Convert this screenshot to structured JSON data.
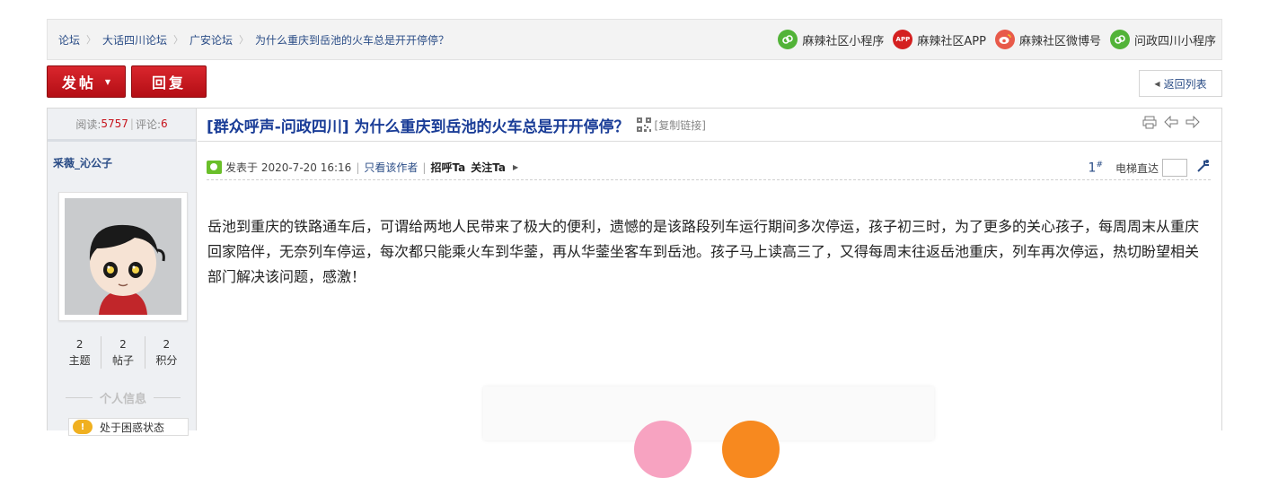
{
  "breadcrumb": {
    "items": [
      "论坛",
      "大话四川论坛",
      "广安论坛",
      "为什么重庆到岳池的火车总是开开停停？"
    ]
  },
  "quicklinks": [
    {
      "icon": "wechat-mini-program-icon",
      "label": "麻辣社区小程序"
    },
    {
      "icon": "app-icon",
      "icon_text": "APP",
      "label": "麻辣社区APP"
    },
    {
      "icon": "weibo-icon",
      "label": "麻辣社区微博号"
    },
    {
      "icon": "wechat-mini-program-icon",
      "label": "问政四川小程序"
    }
  ],
  "toolbar": {
    "post_label": "发帖",
    "reply_label": "回复",
    "back_label": "返回列表"
  },
  "sidebar": {
    "views_label": "阅读:",
    "views": "5757",
    "comments_label": "评论:",
    "comments": "6",
    "author": "釆薇_沁公子",
    "stats": [
      {
        "value": "2",
        "label": "主题"
      },
      {
        "value": "2",
        "label": "帖子"
      },
      {
        "value": "2",
        "label": "积分"
      }
    ],
    "info_heading": "个人信息",
    "medal_text": "处于困惑状态"
  },
  "thread": {
    "title": "[群众呼声-问政四川] 为什么重庆到岳池的火车总是开开停停？",
    "copy_link": "[复制链接]"
  },
  "post": {
    "posted_label": "发表于 2020-7-20 16:16",
    "only_author": "只看该作者",
    "greet": "招呼Ta",
    "follow": "关注Ta",
    "floor": "1",
    "floor_mark": "#",
    "jump_label": "电梯直达",
    "body": "岳池到重庆的铁路通车后，可谓给两地人民带来了极大的便利，遗憾的是该路段列车运行期间多次停运，孩子初三时，为了更多的关心孩子，每周周末从重庆回家陪伴，无奈列车停运，每次都只能乘火车到华蓥，再从华蓥坐客车到岳池。孩子马上读高三了，又得每周末往返岳池重庆，列车再次停运，热切盼望相关部门解决该问题，感激！"
  },
  "colors": {
    "accent_red": "#c7131c",
    "link_blue": "#2a4c86",
    "title_blue": "#1a3d97"
  }
}
